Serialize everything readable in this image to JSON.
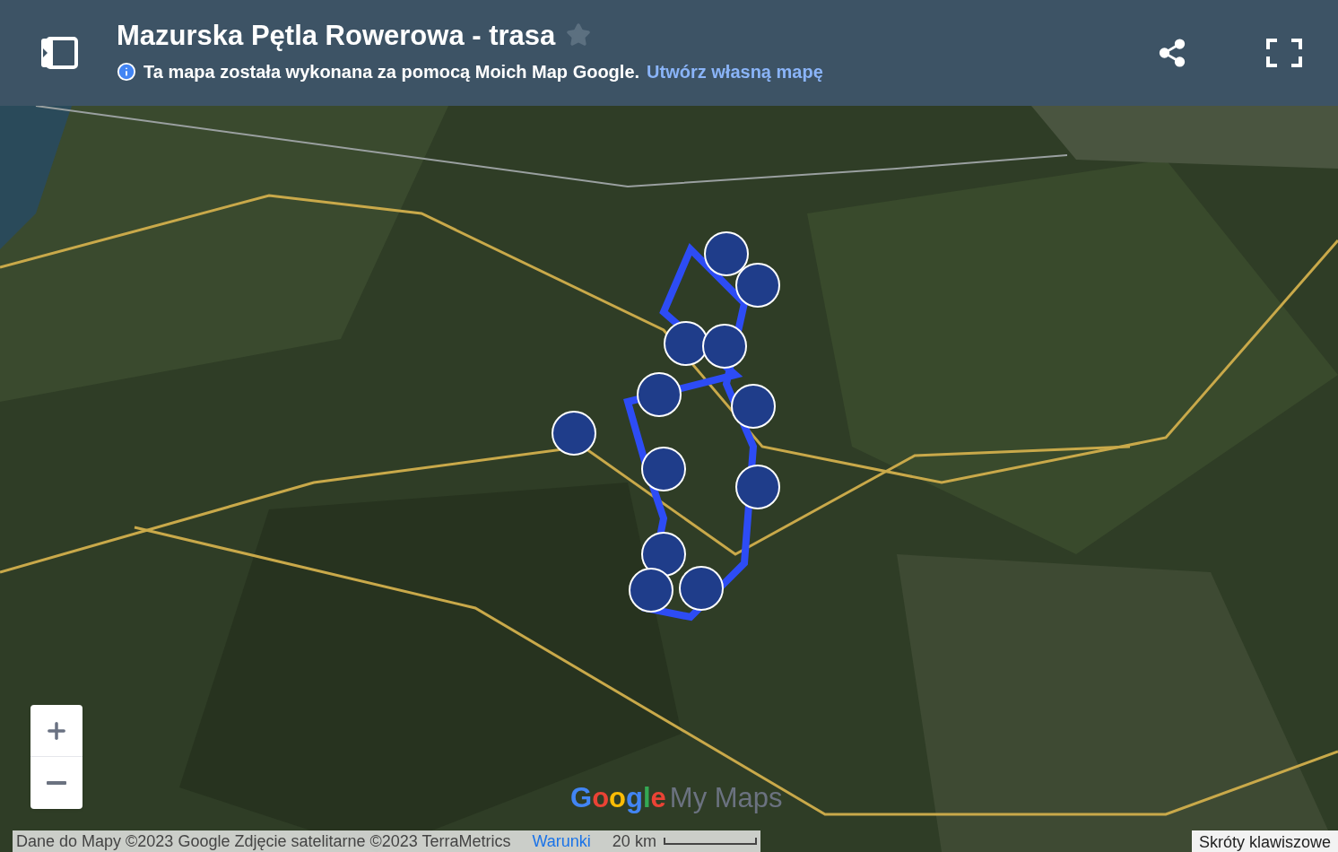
{
  "header": {
    "title": "Mazurska Pętla Rowerowa - trasa",
    "starred": false,
    "notice": "Ta mapa została wykonana za pomocą Moich Map Google.",
    "notice_link": "Utwórz własną mapę"
  },
  "logo": {
    "brand": "Google",
    "product": "My Maps"
  },
  "attribution": {
    "text": "Dane do Mapy ©2023 Google Zdjęcie satelitarne ©2023 TerraMetrics",
    "terms_link": "Warunki",
    "scale": "20 km"
  },
  "shortcuts": "Skróty klawiszowe"
}
